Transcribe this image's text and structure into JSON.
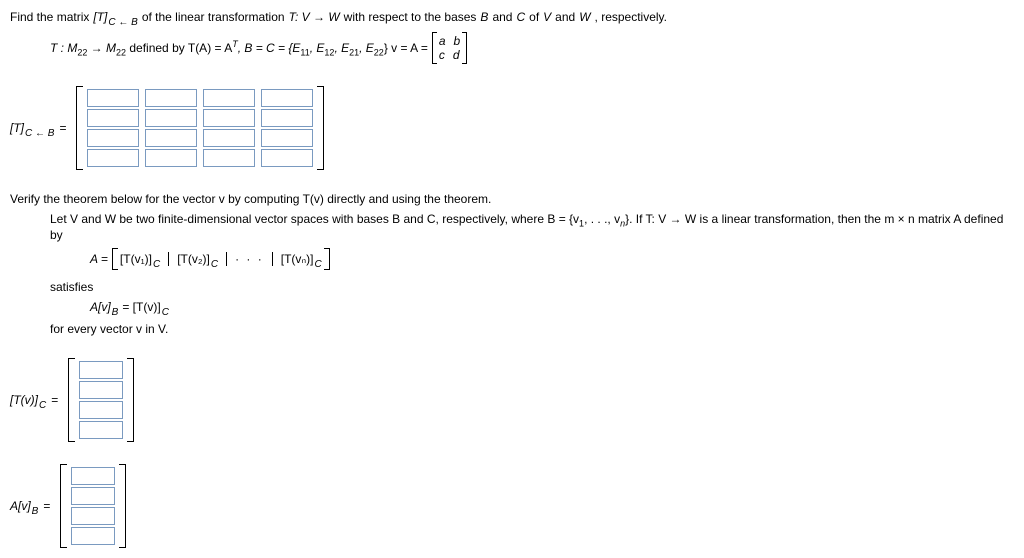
{
  "p1_a": "Find the matrix",
  "p1_expr": "[T]",
  "p1_sub": "C ← B",
  "p1_b": "of the linear transformation",
  "p1_c": "T: V → W",
  "p1_d": "with respect to the bases",
  "p1_e": "B",
  "p1_f": "and",
  "p1_g": "C",
  "p1_h": "of",
  "p1_i": "V",
  "p1_j": "and",
  "p1_k": "W",
  "p1_l": ", respectively.",
  "p2_a": "T : M",
  "p2_a_sub": "22",
  "p2_b": " → M",
  "p2_b_sub": "22",
  "p2_c": "  defined by  T(A) = A",
  "p2_c_sup": "T",
  "p2_d": ", B = C = {E",
  "p2_e11": "11",
  "p2_comma": ", E",
  "p2_e12": "12",
  "p2_e21": "21",
  "p2_e22": "22",
  "p2_f": "} v = A =",
  "mat_a": "a",
  "mat_b": "b",
  "mat_c": "c",
  "mat_d": "d",
  "lblTCB": "[T]",
  "lblTCB_sub": "C ← B",
  "eq": " = ",
  "verify": "Verify the theorem below for the vector v by computing T(v) directly and using the theorem.",
  "let_a": "Let V and W be two finite-dimensional vector spaces with bases B and C, respectively, where B = {v",
  "let_sub1": "1",
  "let_b": ", . . ., v",
  "let_subn": "n",
  "let_c": "}. If T: V → W is a linear transformation, then the m × n matrix A defined by",
  "Aeq": "A =",
  "col1": "[T(v₁)]",
  "col2": "[T(v₂)]",
  "coln": "[T(vₙ)]",
  "colsub": "C",
  "dots": "· · ·",
  "satisfies": "satisfies",
  "AvB": "A[v]",
  "AvB_sub": "B",
  "eq2": " = [T(v)]",
  "eq2_sub": "C",
  "forevery": "for every vector v in V.",
  "lblTvC": "[T(v)]",
  "lblTvC_sub": "C",
  "lblAvB": "A[v]",
  "lblAvB_sub": "B"
}
